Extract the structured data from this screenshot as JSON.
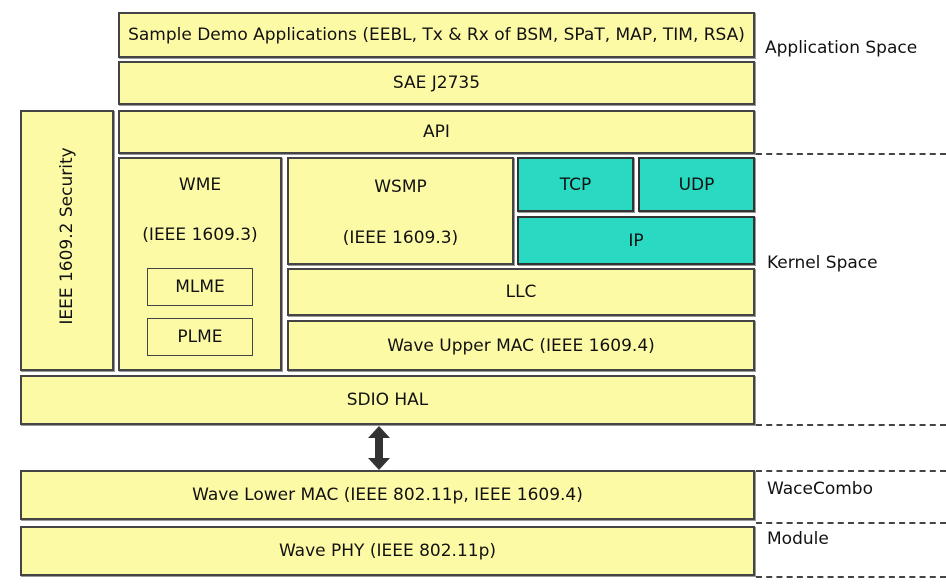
{
  "blocks": {
    "apps": "Sample Demo Applications (EEBL, Tx & Rx of BSM, SPaT, MAP, TIM, RSA)",
    "sae": "SAE J2735",
    "api": "API",
    "security": "IEEE 1609.2 Security",
    "wme": "WME",
    "wme_std": "(IEEE 1609.3)",
    "mlme": "MLME",
    "plme": "PLME",
    "wsmp": "WSMP",
    "wsmp_std": "(IEEE 1609.3)",
    "tcp": "TCP",
    "udp": "UDP",
    "ip": "IP",
    "llc": "LLC",
    "upper_mac": "Wave Upper MAC (IEEE 1609.4)",
    "sdio": "SDIO HAL",
    "lower_mac": "Wave Lower MAC (IEEE 802.11p, IEEE 1609.4)",
    "phy": "Wave PHY (IEEE 802.11p)"
  },
  "regions": {
    "application": "Application Space",
    "kernel": "Kernel Space",
    "wacecombo": "WaceCombo",
    "module": "Module"
  },
  "colors": {
    "block_fill": "#fdfaa6",
    "network_fill": "#2ad9c2",
    "border": "#444444"
  }
}
